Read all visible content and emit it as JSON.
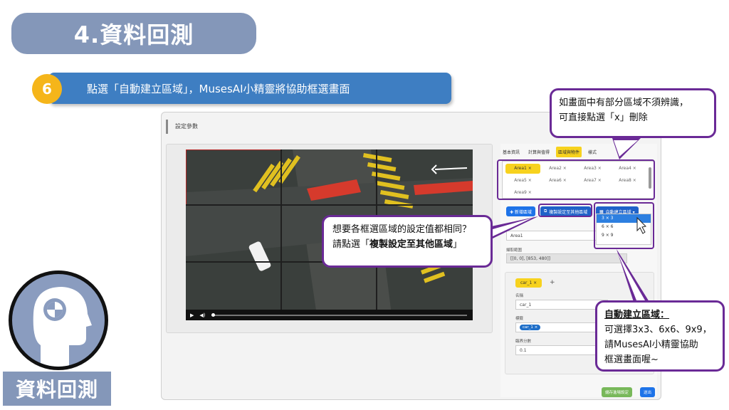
{
  "slide": {
    "title": "4.資料回測",
    "step_number": "6",
    "step_text": "點選「自動建立區域」，MusesAI小精靈將協助框選畫面",
    "corner_label": "資料回測"
  },
  "app": {
    "title": "設定參數",
    "tabs": [
      "基本資訊",
      "計算與值得",
      "區域與物件",
      "樣式"
    ],
    "areas": [
      "Area1 ×",
      "Area2 ×",
      "Area3 ×",
      "Area4 ×",
      "Area5 ×",
      "Area6 ×",
      "Area7 ×",
      "Area8 ×",
      "Area9 ×"
    ],
    "buttons": {
      "add_area": "✚ 新增區域",
      "copy_settings": "複製設定至其他區域",
      "auto_area": "自動建立區域 ▾"
    },
    "auto_options": [
      "3 × 3",
      "6 × 6",
      "9 × 9"
    ],
    "area_name_value": "Area1",
    "range_label": "擷取範圍",
    "range_value": "[[0, 0], [853, 480]]",
    "object_chip": "car_1 ×",
    "add_symbol": "+",
    "name_label": "名稱",
    "name_value": "car_1",
    "tag_label": "標籤",
    "tag_value": "car_1 ×",
    "threshold_label": "臨界分數",
    "threshold_value": "0.1",
    "footer_primary": "儲存進場設定",
    "footer_secondary": "送出"
  },
  "callouts": {
    "top_right": [
      "如畫面中有部分區域不須辨識，",
      "可直接點選「x」刪除"
    ],
    "middle": [
      "想要各框選區域的設定值都相同？",
      "請點選「",
      "複製設定至其他區域",
      "」"
    ],
    "bottom_right_title": "自動建立區域：",
    "bottom_right_body": [
      "可選擇3x3、6x6、9x9，",
      "請MusesAI小精靈協助",
      "框選畫面喔~"
    ]
  },
  "colors": {
    "accent_purple": "#6a2a96",
    "title_blue_gray": "#8497b9",
    "step_blue": "#3e7ec2",
    "step_yellow": "#f5b51a",
    "chip_yellow": "#f7d21e"
  }
}
